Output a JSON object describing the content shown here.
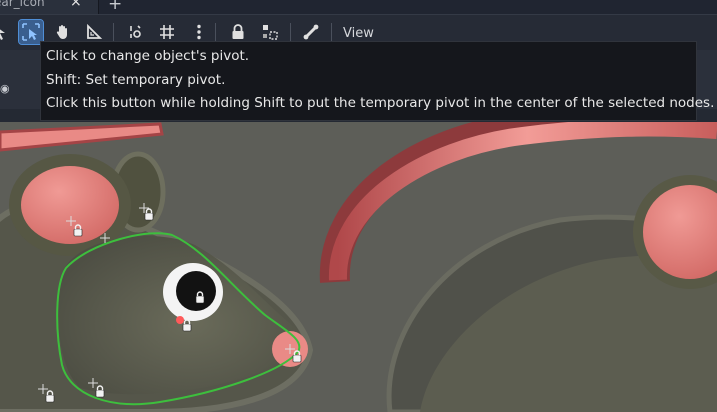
{
  "tabs": {
    "active_label": "ear_icon",
    "close_glyph": "×",
    "add_glyph": "+"
  },
  "toolbar": {
    "tools": [
      {
        "name": "select-tool-icon",
        "active": false
      },
      {
        "name": "change-pivot-tool-icon",
        "active": true
      },
      {
        "name": "pan-tool-icon",
        "active": false
      },
      {
        "name": "ruler-tool-icon",
        "active": false
      },
      {
        "name": "smart-snap-icon",
        "active": false
      },
      {
        "name": "grid-snap-icon",
        "active": false
      },
      {
        "name": "more-options-icon",
        "active": false
      },
      {
        "name": "lock-icon",
        "active": false
      },
      {
        "name": "group-icon",
        "active": false
      },
      {
        "name": "skeleton-bone-icon",
        "active": false
      }
    ],
    "view_label": "View"
  },
  "tooltip": {
    "line1": "Click to change object's pivot.",
    "line2": "Shift: Set temporary pivot.",
    "line3": "Click this button while holding Shift to put the temporary pivot in the center of the selected nodes."
  },
  "colors": {
    "selection_outline": "#3dbf3d",
    "accent": "#4f8ed6",
    "ear_pink": "#e98a86"
  }
}
